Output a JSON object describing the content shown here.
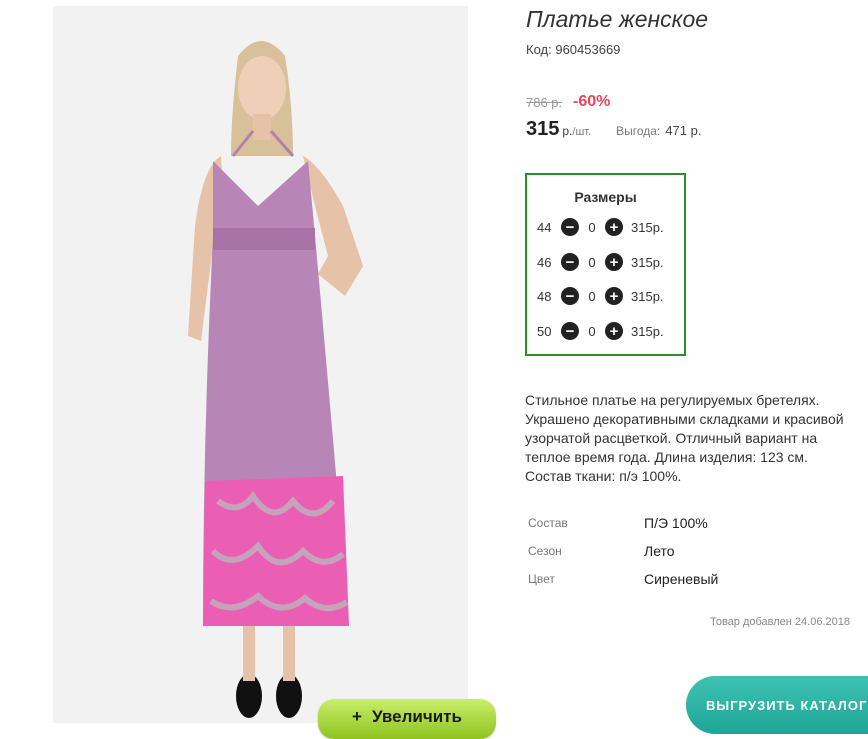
{
  "product": {
    "title": "Платье женское",
    "code_label": "Код:",
    "code": "960453669",
    "zoom_label": "Увеличить",
    "zoom_icon": "+"
  },
  "pricing": {
    "old_price": "786 р.",
    "discount": "-60%",
    "price": "315",
    "unit": "р.",
    "unit_per": "/шт.",
    "benefit_label": "Выгода:",
    "benefit_value": "471 р."
  },
  "sizes": {
    "title": "Размеры",
    "rows": [
      {
        "size": "44",
        "qty": "0",
        "price": "315р."
      },
      {
        "size": "46",
        "qty": "0",
        "price": "315р."
      },
      {
        "size": "48",
        "qty": "0",
        "price": "315р."
      },
      {
        "size": "50",
        "qty": "0",
        "price": "315р."
      }
    ]
  },
  "description": "Стильное платье на регулируемых бретелях. Украшено декоративными складками и красивой узорчатой расцветкой. Отличный вариант на теплое время года. Длина изделия: 123 см. Состав ткани: п/э 100%.",
  "attributes": [
    {
      "key": "Состав",
      "value": "П/Э 100%"
    },
    {
      "key": "Сезон",
      "value": "Лето"
    },
    {
      "key": "Цвет",
      "value": "Сиреневый"
    }
  ],
  "added_note": "Товар добавлен 24.06.2018",
  "export_button": "ВЫГРУЗИТЬ КАТАЛОГ",
  "colors": {
    "discount": "#e8455b",
    "sizes_border": "#2e8b2e",
    "zoom_button": "#a8d83a",
    "export_button": "#26ad9f",
    "dress": "#b886b6",
    "dress_print": "#ea5fb4"
  },
  "icons": {
    "minus": "minus-circle-icon",
    "plus": "plus-circle-icon"
  }
}
